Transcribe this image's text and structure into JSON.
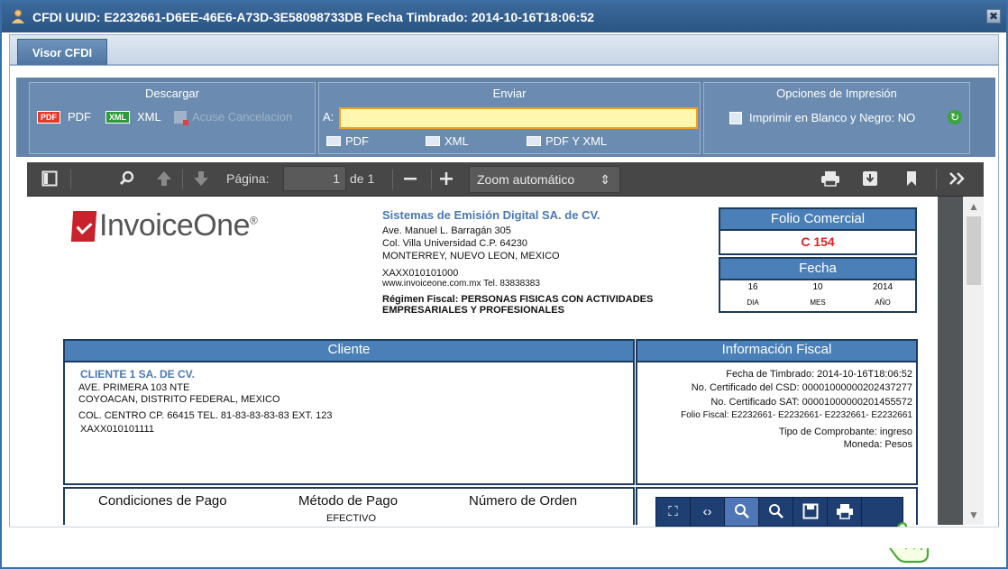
{
  "window": {
    "title": "CFDI UUID: E2232661-D6EE-46E6-A73D-3E58098733DB Fecha Timbrado: 2014-10-16T18:06:52",
    "close_glyph": "✖"
  },
  "tabs": [
    {
      "label": "Visor CFDI"
    }
  ],
  "descargar": {
    "title": "Descargar",
    "pdf_badge": "PDF",
    "pdf_label": "PDF",
    "xml_badge": "XML",
    "xml_label": "XML",
    "acuse_label": "Acuse Cancelacion"
  },
  "enviar": {
    "title": "Enviar",
    "to_label": "A:",
    "to_value": "",
    "btn_pdf": "PDF",
    "btn_xml": "XML",
    "btn_pdf_xml": "PDF Y XML"
  },
  "opciones": {
    "title": "Opciones de Impresión",
    "print_bw": "Imprimir en Blanco y Negro: NO"
  },
  "pdf_toolbar": {
    "page_label": "Página:",
    "page_value": "1",
    "page_of": "de 1",
    "zoom": "Zoom automático"
  },
  "invoice": {
    "logo_text_1": "Invoice",
    "logo_text_2": "One",
    "logo_reg": "®",
    "emisor": {
      "name": "Sistemas de Emisión Digital  SA. de CV.",
      "line1": "Ave. Manuel L. Barragán  305",
      "line2": "Col. Villa Universidad    C.P. 64230",
      "line3": "MONTERREY, NUEVO LEON, MEXICO",
      "rfc": "XAXX010101000",
      "web": "www.invoiceone.com.mx   Tel. 83838383",
      "regimen1": "Régimen Fiscal: PERSONAS FISICAS CON ACTIVIDADES",
      "regimen2": "EMPRESARIALES Y PROFESIONALES"
    },
    "folio": {
      "title": "Folio Comercial",
      "value": "C 154"
    },
    "fecha": {
      "title": "Fecha",
      "day": "16",
      "month": "10",
      "year": "2014",
      "day_label": "DIA",
      "month_label": "MES",
      "year_label": "AÑO"
    },
    "cliente": {
      "title": "Cliente",
      "name": "CLIENTE 1 SA. DE CV.",
      "line1": "AVE. PRIMERA 103 NTE",
      "line2": "COYOACAN, DISTRITO FEDERAL, MEXICO",
      "line3": "COL. CENTRO  CP. 66415  TEL. 81-83-83-83-83  EXT. 123",
      "rfc": "XAXX010101111"
    },
    "fiscal": {
      "title": "Información Fiscal",
      "line1": "Fecha de Timbrado: 2014-10-16T18:06:52",
      "line2": "No. Certificado del CSD: 00001000000202437277",
      "line3": "No. Certificado SAT: 00001000000201455572",
      "line4": "Folio Fiscal: E2232661- E2232661- E2232661- E2232661",
      "line5": "Tipo de Comprobante: ingreso",
      "line6": "Moneda: Pesos"
    },
    "condiciones": {
      "h1": "Condiciones de Pago",
      "h2": "Método de Pago",
      "h3": "Número de Orden",
      "metodo_value": "EFECTIVO"
    }
  }
}
